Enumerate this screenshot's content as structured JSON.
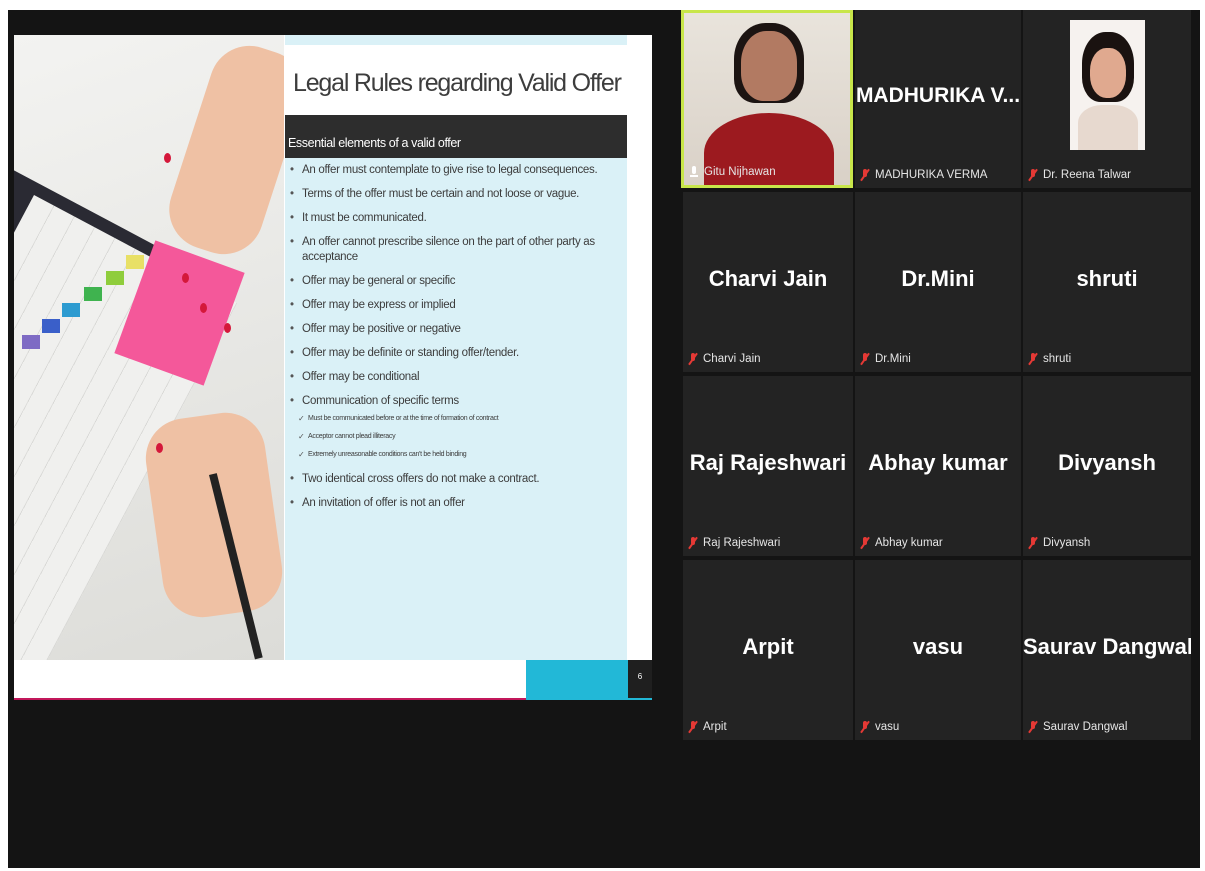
{
  "slide": {
    "title": "Legal Rules regarding Valid Offer",
    "subheading": "Essential elements of a valid offer",
    "bullets": [
      "An offer must contemplate to give rise to legal consequences.",
      "Terms of the offer must be certain and not loose or vague.",
      "It must be communicated.",
      "An offer cannot prescribe silence on the part of other party as acceptance",
      "Offer may be general or specific",
      "Offer may be express or implied",
      "Offer may be positive or negative",
      "Offer may be definite or standing offer/tender.",
      "Offer may be conditional",
      "Communication of specific terms"
    ],
    "sub_bullets": [
      "Must be communicated before or at the time of formation of contract",
      "Acceptor cannot plead illiteracy",
      "Extremely unreasonable conditions can't be held binding"
    ],
    "bullets_after": [
      "Two identical cross offers do not make a contract.",
      "An invitation of offer is not an offer"
    ],
    "page_number": "6"
  },
  "participants": [
    {
      "display": "",
      "label": "Gitu Nijhawan",
      "mic": "on",
      "video": "camera",
      "active": true
    },
    {
      "display": "MADHURIKA  V...",
      "label": "MADHURIKA VERMA",
      "mic": "muted",
      "video": "name"
    },
    {
      "display": "",
      "label": "Dr. Reena Talwar",
      "mic": "muted",
      "video": "photo"
    },
    {
      "display": "Charvi Jain",
      "label": "Charvi Jain",
      "mic": "muted",
      "video": "name"
    },
    {
      "display": "Dr.Mini",
      "label": "Dr.Mini",
      "mic": "muted",
      "video": "name"
    },
    {
      "display": "shruti",
      "label": "shruti",
      "mic": "muted",
      "video": "name"
    },
    {
      "display": "Raj Rajeshwari",
      "label": "Raj Rajeshwari",
      "mic": "muted",
      "video": "name"
    },
    {
      "display": "Abhay kumar",
      "label": "Abhay kumar",
      "mic": "muted",
      "video": "name"
    },
    {
      "display": "Divyansh",
      "label": "Divyansh",
      "mic": "muted",
      "video": "name"
    },
    {
      "display": "Arpit",
      "label": "Arpit",
      "mic": "muted",
      "video": "name"
    },
    {
      "display": "vasu",
      "label": "vasu",
      "mic": "muted",
      "video": "name"
    },
    {
      "display": "Saurav Dangwal",
      "label": "Saurav Dangwal",
      "mic": "muted",
      "video": "name"
    }
  ],
  "colors": {
    "active_speaker_border": "#c8e64a",
    "muted_mic": "#e53935",
    "tile_bg": "#232323",
    "slide_accent_cyan": "#22b8d7",
    "slide_accent_pink": "#c2185b"
  }
}
